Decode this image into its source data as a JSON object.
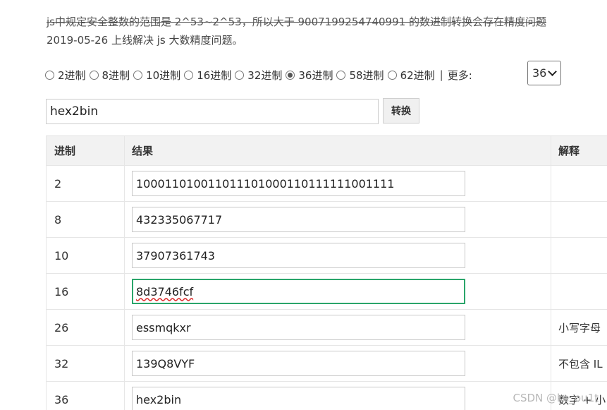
{
  "notice": {
    "line1": "js中规定安全整数的范围是 2^53~2^53，所以大于 9007199254740991 的数进制转换会存在精度问题",
    "line2": "2019-05-26 上线解决 js 大数精度问题。"
  },
  "radios": [
    {
      "label": "2进制",
      "checked": false
    },
    {
      "label": "8进制",
      "checked": false
    },
    {
      "label": "10进制",
      "checked": false
    },
    {
      "label": "16进制",
      "checked": false
    },
    {
      "label": "32进制",
      "checked": false
    },
    {
      "label": "36进制",
      "checked": true
    },
    {
      "label": "58进制",
      "checked": false
    },
    {
      "label": "62进制",
      "checked": false
    }
  ],
  "separator": "|",
  "more_label": "更多:",
  "more_select_value": "36",
  "input_value": "hex2bin",
  "convert_label": "转换",
  "table": {
    "headers": [
      "进制",
      "结果",
      "解释"
    ],
    "rows": [
      {
        "base": "2",
        "value": "100011010011011101000110111111001111",
        "note": ""
      },
      {
        "base": "8",
        "value": "432335067717",
        "note": ""
      },
      {
        "base": "10",
        "value": "37907361743",
        "note": ""
      },
      {
        "base": "16",
        "value": "8d3746fcf",
        "note": ""
      },
      {
        "base": "26",
        "value": "essmqkxr",
        "note": "小写字母"
      },
      {
        "base": "32",
        "value": "139Q8VYF",
        "note": "不包含 IL"
      },
      {
        "base": "36",
        "value": "hex2bin",
        "note": "数字 + 小"
      }
    ]
  },
  "watermark": "CSDN @ke_ou1t"
}
